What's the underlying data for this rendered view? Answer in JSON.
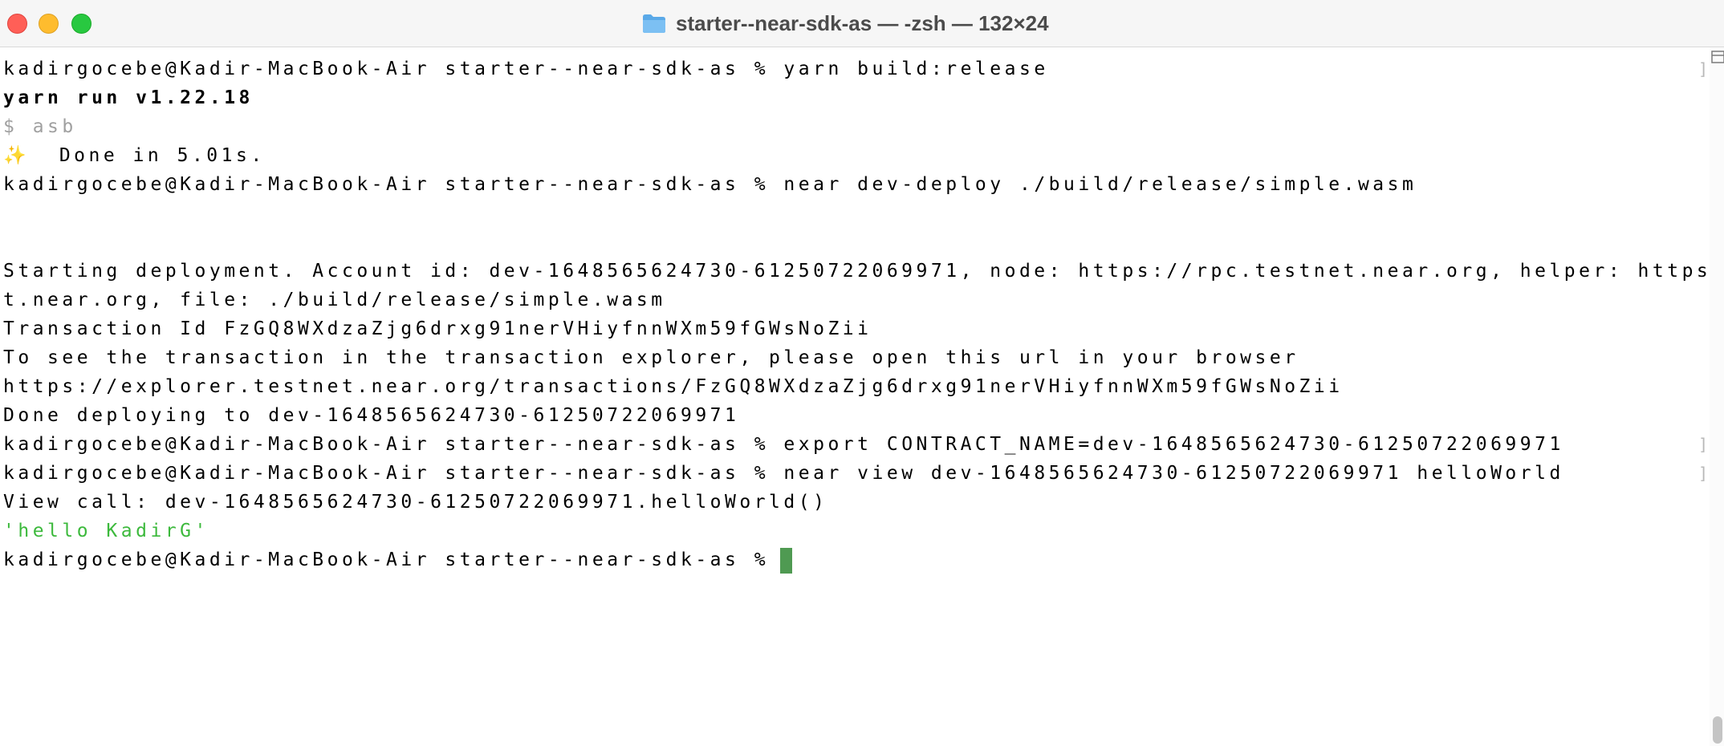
{
  "window": {
    "title": "starter--near-sdk-as — -zsh — 132×24",
    "folder_icon": "folder-icon",
    "traffic_lights": {
      "close": "#ff5f57",
      "minimize": "#febc2e",
      "zoom": "#28c840"
    }
  },
  "terminal": {
    "lines": [
      {
        "prompt": "kadirgocebe@Kadir-MacBook-Air starter--near-sdk-as %",
        "command": "yarn build:release"
      },
      {
        "text": "yarn run v1.22.18"
      },
      {
        "text": "$ asb"
      },
      {
        "sparkle": "✨",
        "text": "  Done in 5.01s."
      },
      {
        "prompt": "kadirgocebe@Kadir-MacBook-Air starter--near-sdk-as %",
        "command": "near dev-deploy ./build/release/simple.wasm"
      },
      {
        "text": "Starting deployment. Account id: dev-1648565624730-61250722069971, node: https://rpc.testnet.near.org, helper: https://helper.testne"
      },
      {
        "text": "t.near.org, file: ./build/release/simple.wasm"
      },
      {
        "text": "Transaction Id FzGQ8WXdzaZjg6drxg91nerVHiyfnnWXm59fGWsNoZii"
      },
      {
        "text": "To see the transaction in the transaction explorer, please open this url in your browser"
      },
      {
        "text": "https://explorer.testnet.near.org/transactions/FzGQ8WXdzaZjg6drxg91nerVHiyfnnWXm59fGWsNoZii"
      },
      {
        "text": "Done deploying to dev-1648565624730-61250722069971"
      },
      {
        "prompt": "kadirgocebe@Kadir-MacBook-Air starter--near-sdk-as %",
        "command": "export CONTRACT_NAME=dev-1648565624730-61250722069971"
      },
      {
        "prompt": "kadirgocebe@Kadir-MacBook-Air starter--near-sdk-as %",
        "command": "near view dev-1648565624730-61250722069971 helloWorld"
      },
      {
        "text": "View call: dev-1648565624730-61250722069971.helloWorld()"
      },
      {
        "text": "'hello KadirG'"
      },
      {
        "prompt": "kadirgocebe@Kadir-MacBook-Air starter--near-sdk-as %",
        "command": ""
      }
    ],
    "right_marker": "]",
    "colors": {
      "text": "#000000",
      "dim": "#a0a0a0",
      "string_output": "#3cb93c",
      "cursor": "#4f9a52"
    }
  }
}
